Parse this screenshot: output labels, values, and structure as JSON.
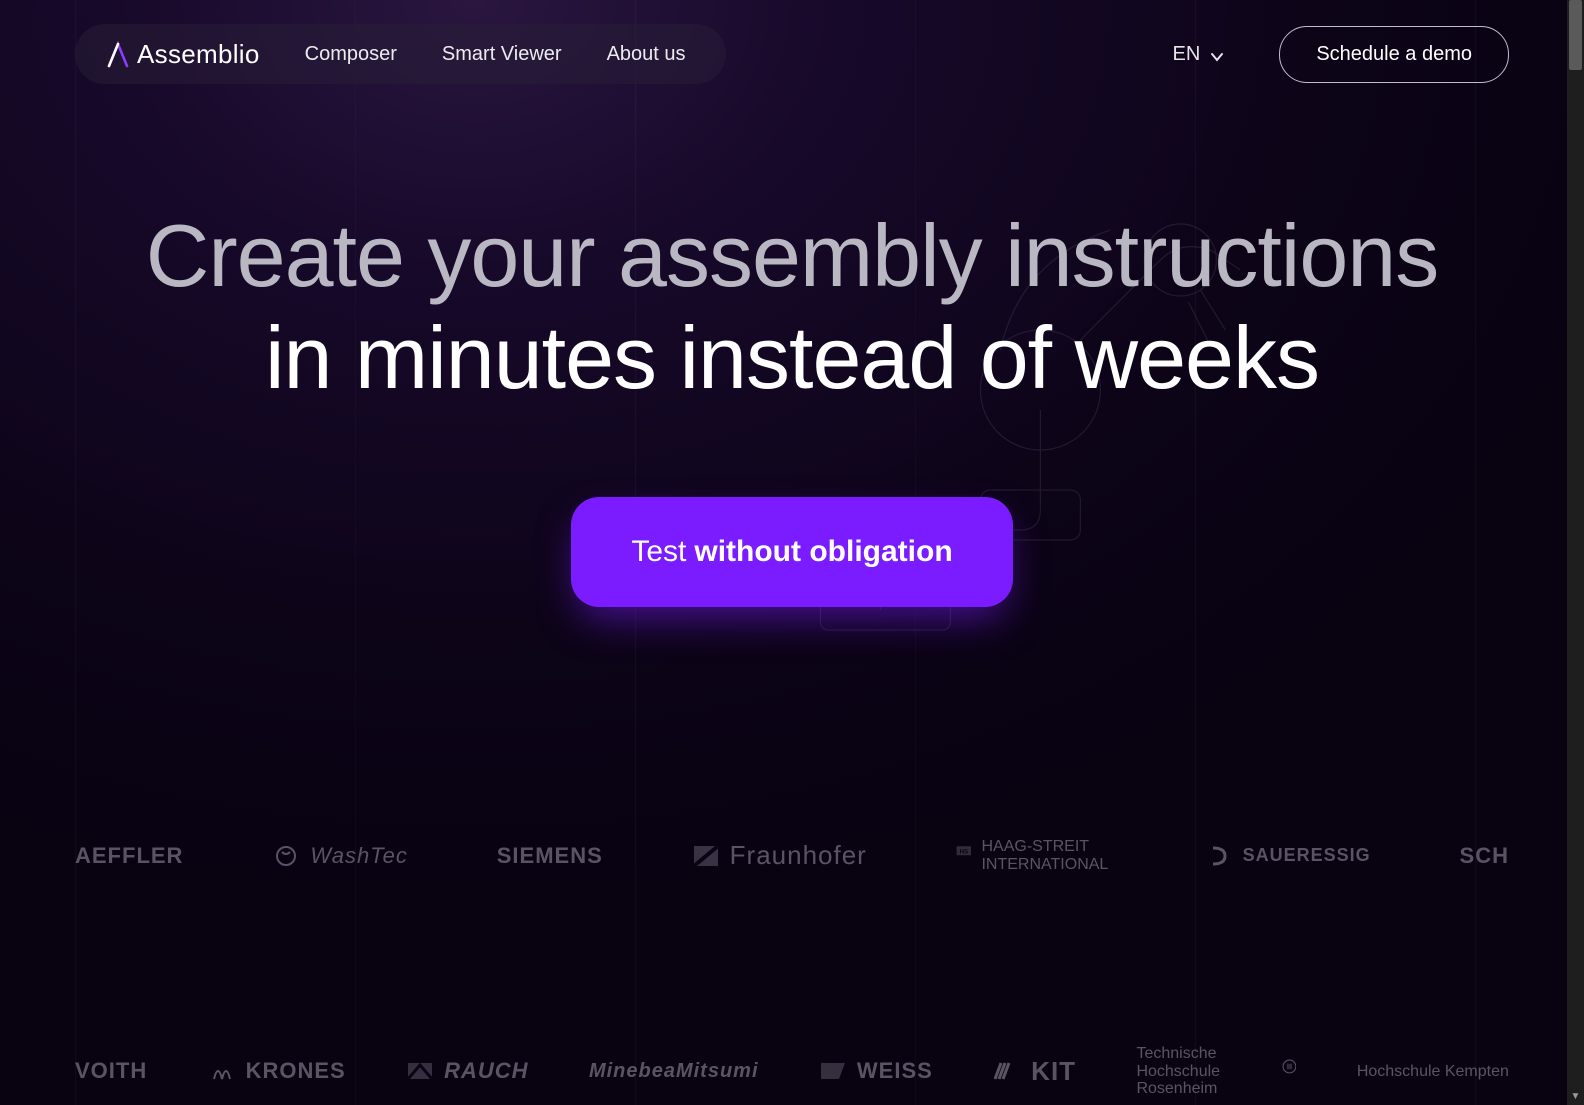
{
  "brand": {
    "name": "Assemblio"
  },
  "nav": {
    "items": [
      {
        "label": "Composer"
      },
      {
        "label": "Smart Viewer"
      },
      {
        "label": "About us"
      }
    ]
  },
  "lang": {
    "current": "EN"
  },
  "header": {
    "demo_button": "Schedule a demo"
  },
  "hero": {
    "line1": "Create your assembly instructions",
    "line2": "in minutes instead of weeks",
    "cta_light": "Test",
    "cta_bold": "without obligation"
  },
  "partners_row1": [
    {
      "name": "AEFFLER"
    },
    {
      "name": "WashTec"
    },
    {
      "name": "SIEMENS"
    },
    {
      "name": "Fraunhofer"
    },
    {
      "name": "HAAG-STREIT INTERNATIONAL"
    },
    {
      "name": "SAUERESSIG"
    },
    {
      "name": "SCH"
    }
  ],
  "partners_row2": [
    {
      "name": "VOITH"
    },
    {
      "name": "KRONES"
    },
    {
      "name": "RAUCH"
    },
    {
      "name": "MinebeaMitsumi"
    },
    {
      "name": "WEISS"
    },
    {
      "name": "KIT"
    },
    {
      "name": "Technische Hochschule Rosenheim"
    },
    {
      "name": "Hochschule Kempten"
    }
  ]
}
